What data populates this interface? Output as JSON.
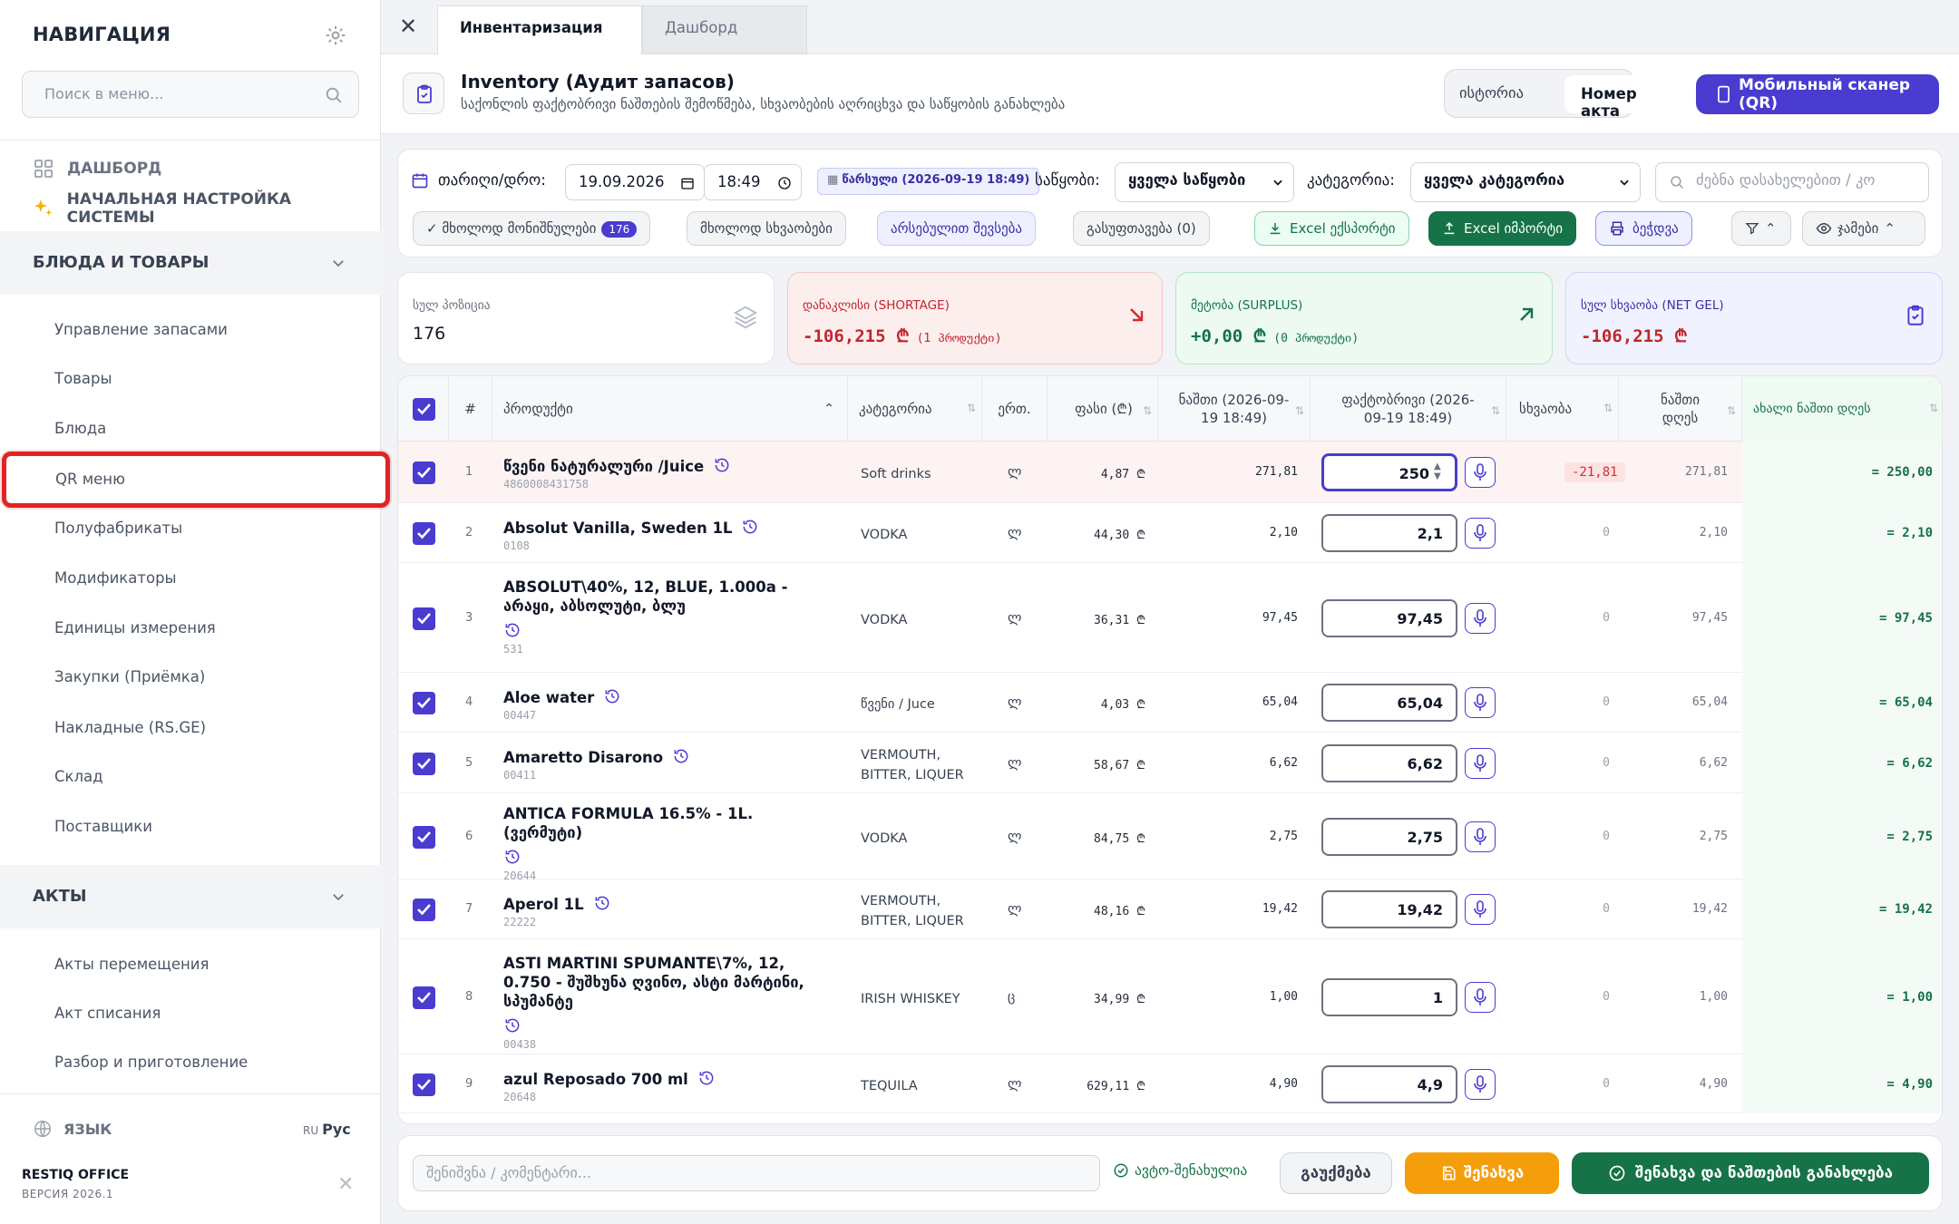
{
  "sidebar": {
    "title": "НАВИГАЦИЯ",
    "search_placeholder": "Поиск в меню...",
    "top_links": [
      {
        "label": "ДАШБОРД",
        "icon": "dashboard-grid-icon"
      },
      {
        "label": "НАЧАЛЬНАЯ НАСТРОЙКА СИСТЕМЫ",
        "icon": "sparkles-icon"
      }
    ],
    "section_dishes": "БЛЮДА И ТОВАРЫ",
    "items": [
      "Управление запасами",
      "Товары",
      "Блюда",
      "QR меню",
      "Полуфабрикаты",
      "Модификаторы",
      "Единицы измерения",
      "Закупки (Приёмка)",
      "Накладные (RS.GE)",
      "Склад",
      "Поставщики"
    ],
    "section_acts": "АКТЫ",
    "act_items": [
      "Акты перемещения",
      "Акт списания",
      "Разбор и приготовление"
    ],
    "language_label": "ЯЗЫК",
    "language_code": "RU",
    "language_value": "Рус",
    "brand": "RESTIQ OFFICE",
    "version": "ВЕРСИЯ 2026.1"
  },
  "tabs": {
    "active": "Инвентаризация",
    "inactive": "Дашборд"
  },
  "header": {
    "title": "Inventory (Аудит запасов)",
    "subtitle": "საქონლის ფაქტობრივი ნაშთების შემოწმება, სხვაობების აღრიცხვა და საწყობის განახლება",
    "seg_history": "ისტორია",
    "seg_act": "Номер акта",
    "scan_button": "Мобильный сканер (QR)"
  },
  "filters": {
    "date_label": "თარიღი/დრო:",
    "date_value": "19.09.2026",
    "time_value": "18:49",
    "draft_chip": "წარსული (2026-09-19 18:49)",
    "warehouse_label": "საწყობი:",
    "warehouse_value": "ყველა საწყობი",
    "category_label": "კატეგორია:",
    "category_value": "ყველა კატეგორია",
    "search_placeholder": "ძებნა დასახელებით / კო",
    "only_marked": "✓ მხოლოდ მონიშნულები",
    "marked_count": "176",
    "only_diff": "მხოლოდ სხვაობები",
    "fill_actual": "არსებულით შევსება",
    "clear": "გასუფთავება (0)",
    "excel_export": "Excel ექსპორტი",
    "excel_import": "Excel იმპორტი",
    "print": "ბეჭდვა",
    "columns": "ჯამები"
  },
  "stats": {
    "total_label": "სულ პოზიცია",
    "total_value": "176",
    "shortage_label": "დანაკლისი (SHORTAGE)",
    "shortage_value": "-106,215 ₾",
    "shortage_note": "(1 პროდუქტი)",
    "surplus_label": "მეტობა (SURPLUS)",
    "surplus_value": "+0,00 ₾",
    "surplus_note": "(0 პროდუქტი)",
    "net_label": "სულ სხვაობა (NET GEL)",
    "net_value": "-106,215 ₾"
  },
  "table": {
    "headers": {
      "num": "#",
      "product": "პროდუქტი",
      "category": "კატეგორია",
      "unit": "ერთ.",
      "price": "ფასი (₾)",
      "balance": "ნაშთი (2026-09-19 18:49)",
      "actual": "ფაქტობრივი (2026-09-19 18:49)",
      "diff": "სხვაობა",
      "balance_today": "ნაშთი დღეს",
      "new_balance": "ახალი ნაშთი დღეს"
    },
    "rows": [
      {
        "n": "1",
        "name": "წვენი ნატურალური /Juice",
        "code": "4860008431758",
        "cat": "Soft drinks",
        "unit": "ლ",
        "price": "4,87 ₾",
        "bal": "271,81",
        "actual": "250",
        "diff": "-21,81",
        "today": "271,81",
        "new": "= 250,00"
      },
      {
        "n": "2",
        "name": "Absolut Vanilla, Sweden 1L",
        "code": "0108",
        "cat": "VODKA",
        "unit": "ლ",
        "price": "44,30 ₾",
        "bal": "2,10",
        "actual": "2,1",
        "diff": "0",
        "today": "2,10",
        "new": "= 2,10"
      },
      {
        "n": "3",
        "name": "ABSOLUT\\40%, 12, BLUE, 1.000a - არაყი, აბსოლუტი, ბლუ",
        "code": "531",
        "cat": "VODKA",
        "unit": "ლ",
        "price": "36,31 ₾",
        "bal": "97,45",
        "actual": "97,45",
        "diff": "0",
        "today": "97,45",
        "new": "= 97,45"
      },
      {
        "n": "4",
        "name": "Aloe water",
        "code": "00447",
        "cat": "წვენი / Juce",
        "unit": "ლ",
        "price": "4,03 ₾",
        "bal": "65,04",
        "actual": "65,04",
        "diff": "0",
        "today": "65,04",
        "new": "= 65,04"
      },
      {
        "n": "5",
        "name": "Amaretto Disarono",
        "code": "00411",
        "cat": "VERMOUTH, BITTER, LIQUER",
        "unit": "ლ",
        "price": "58,67 ₾",
        "bal": "6,62",
        "actual": "6,62",
        "diff": "0",
        "today": "6,62",
        "new": "= 6,62"
      },
      {
        "n": "6",
        "name": "ANTICA FORMULA 16.5% - 1L. (ვერმუტი)",
        "code": "20644",
        "cat": "VODKA",
        "unit": "ლ",
        "price": "84,75 ₾",
        "bal": "2,75",
        "actual": "2,75",
        "diff": "0",
        "today": "2,75",
        "new": "= 2,75"
      },
      {
        "n": "7",
        "name": "Aperol 1L",
        "code": "22222",
        "cat": "VERMOUTH, BITTER, LIQUER",
        "unit": "ლ",
        "price": "48,16 ₾",
        "bal": "19,42",
        "actual": "19,42",
        "diff": "0",
        "today": "19,42",
        "new": "= 19,42"
      },
      {
        "n": "8",
        "name": "ASTI MARTINI SPUMANTE\\7%, 12, 0.750 - შუშხუნა ღვინო, ასტი მარტინი, სპუმანტე",
        "code": "00438",
        "cat": "IRISH WHISKEY",
        "unit": "ც",
        "price": "34,99 ₾",
        "bal": "1,00",
        "actual": "1",
        "diff": "0",
        "today": "1,00",
        "new": "= 1,00"
      },
      {
        "n": "9",
        "name": "azul Reposado 700 ml",
        "code": "20648",
        "cat": "TEQUILA",
        "unit": "ლ",
        "price": "629,11 ₾",
        "bal": "4,90",
        "actual": "4,9",
        "diff": "0",
        "today": "4,90",
        "new": "= 4,90"
      }
    ]
  },
  "footer": {
    "comment_placeholder": "შენიშვნა / კომენტარი...",
    "autosave": "ავტო-შენახულია",
    "cancel": "გაუქმება",
    "save": "შენახვა",
    "apply": "შენახვა და ნაშთების განახლება"
  },
  "colors": {
    "accent": "#4a3bd1",
    "success": "#157347",
    "danger": "#d12f2f",
    "warning": "#f59e0b",
    "highlight": "#e02424"
  }
}
